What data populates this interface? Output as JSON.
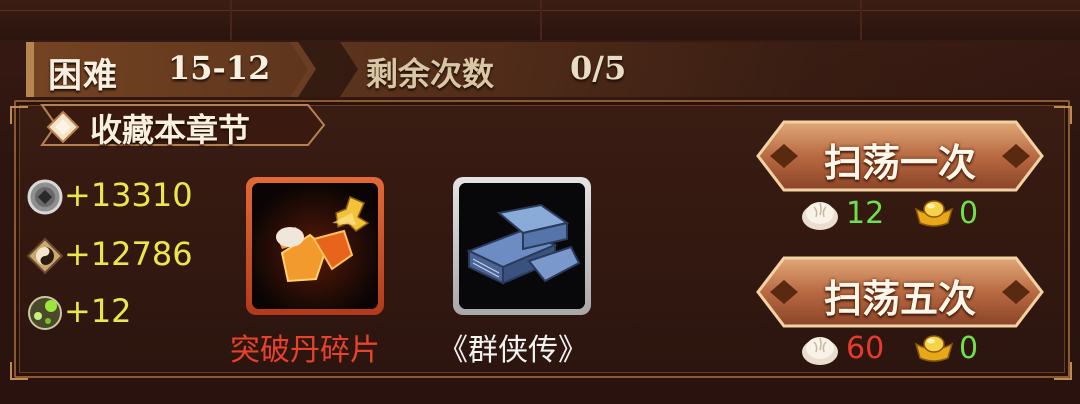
{
  "header": {
    "difficulty": "困难",
    "stage": "15-12",
    "remaining_label": "剩余次数",
    "remaining_value": "0/5"
  },
  "section": {
    "title": "收藏本章节"
  },
  "rewards": [
    {
      "icon": "silver-coin-icon",
      "value": "+13310"
    },
    {
      "icon": "yin-yang-icon",
      "value": "+12786"
    },
    {
      "icon": "skill-orb-icon",
      "value": "+12"
    }
  ],
  "items": [
    {
      "name": "突破丹碎片",
      "icon": "breakthrough-pill-fragment-icon",
      "frame_color": "#d9502a",
      "name_color": "#e8432a"
    },
    {
      "name": "《群侠传》",
      "icon": "book-stack-icon",
      "frame_color": "#cfcfcf",
      "name_color": "#f2f2f2"
    }
  ],
  "sweep_once": {
    "label": "扫荡一次",
    "cost_stamina": "12",
    "cost_stamina_color": "#6fe04a",
    "cost_gold": "0",
    "cost_gold_color": "#6fe04a"
  },
  "sweep_five": {
    "label": "扫荡五次",
    "cost_stamina": "60",
    "cost_stamina_color": "#e83a2a",
    "cost_gold": "0",
    "cost_gold_color": "#6fe04a"
  }
}
